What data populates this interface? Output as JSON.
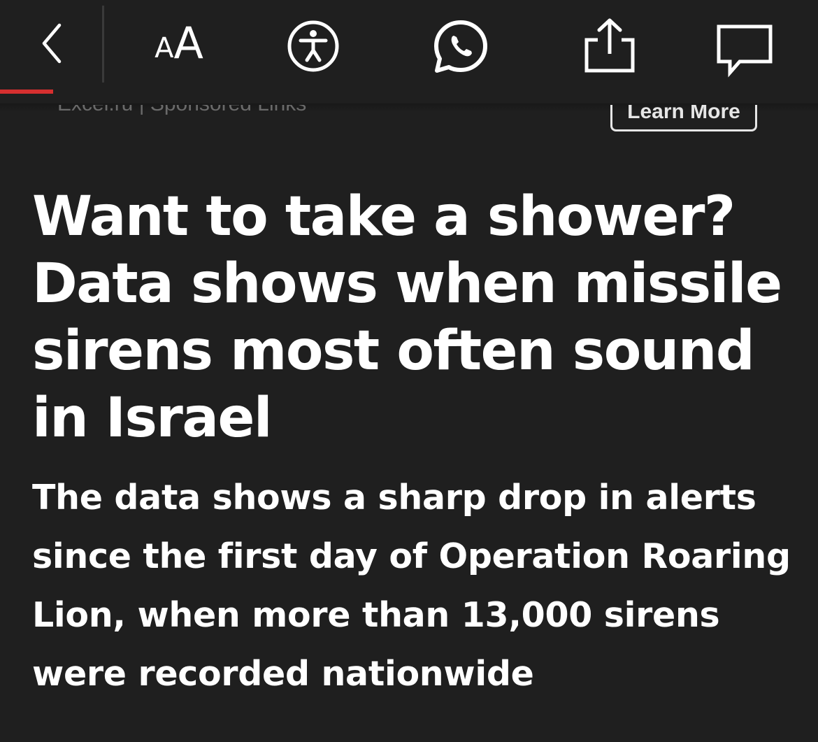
{
  "toolbar": {
    "back_icon": "chevron-left-icon",
    "text_size": {
      "small_letter": "A",
      "large_letter": "A"
    },
    "accessibility_icon": "accessibility-icon",
    "whatsapp_icon": "whatsapp-icon",
    "share_icon": "share-icon",
    "comments_icon": "comment-icon",
    "reading_progress_color": "#d62f2f"
  },
  "ad": {
    "source_text": "Excel.ru | Sponsored Links",
    "cta_label": "Learn More"
  },
  "article": {
    "headline": "Want to take a shower? Data shows when missile sirens most often sound in Israel",
    "subheadline": "The data shows a sharp drop in alerts since the first day of Operation Roaring Lion, when more than 13,000 sirens were recorded nationwide"
  },
  "colors": {
    "background": "#1f1f1f",
    "text": "#ffffff",
    "accent": "#d62f2f"
  }
}
